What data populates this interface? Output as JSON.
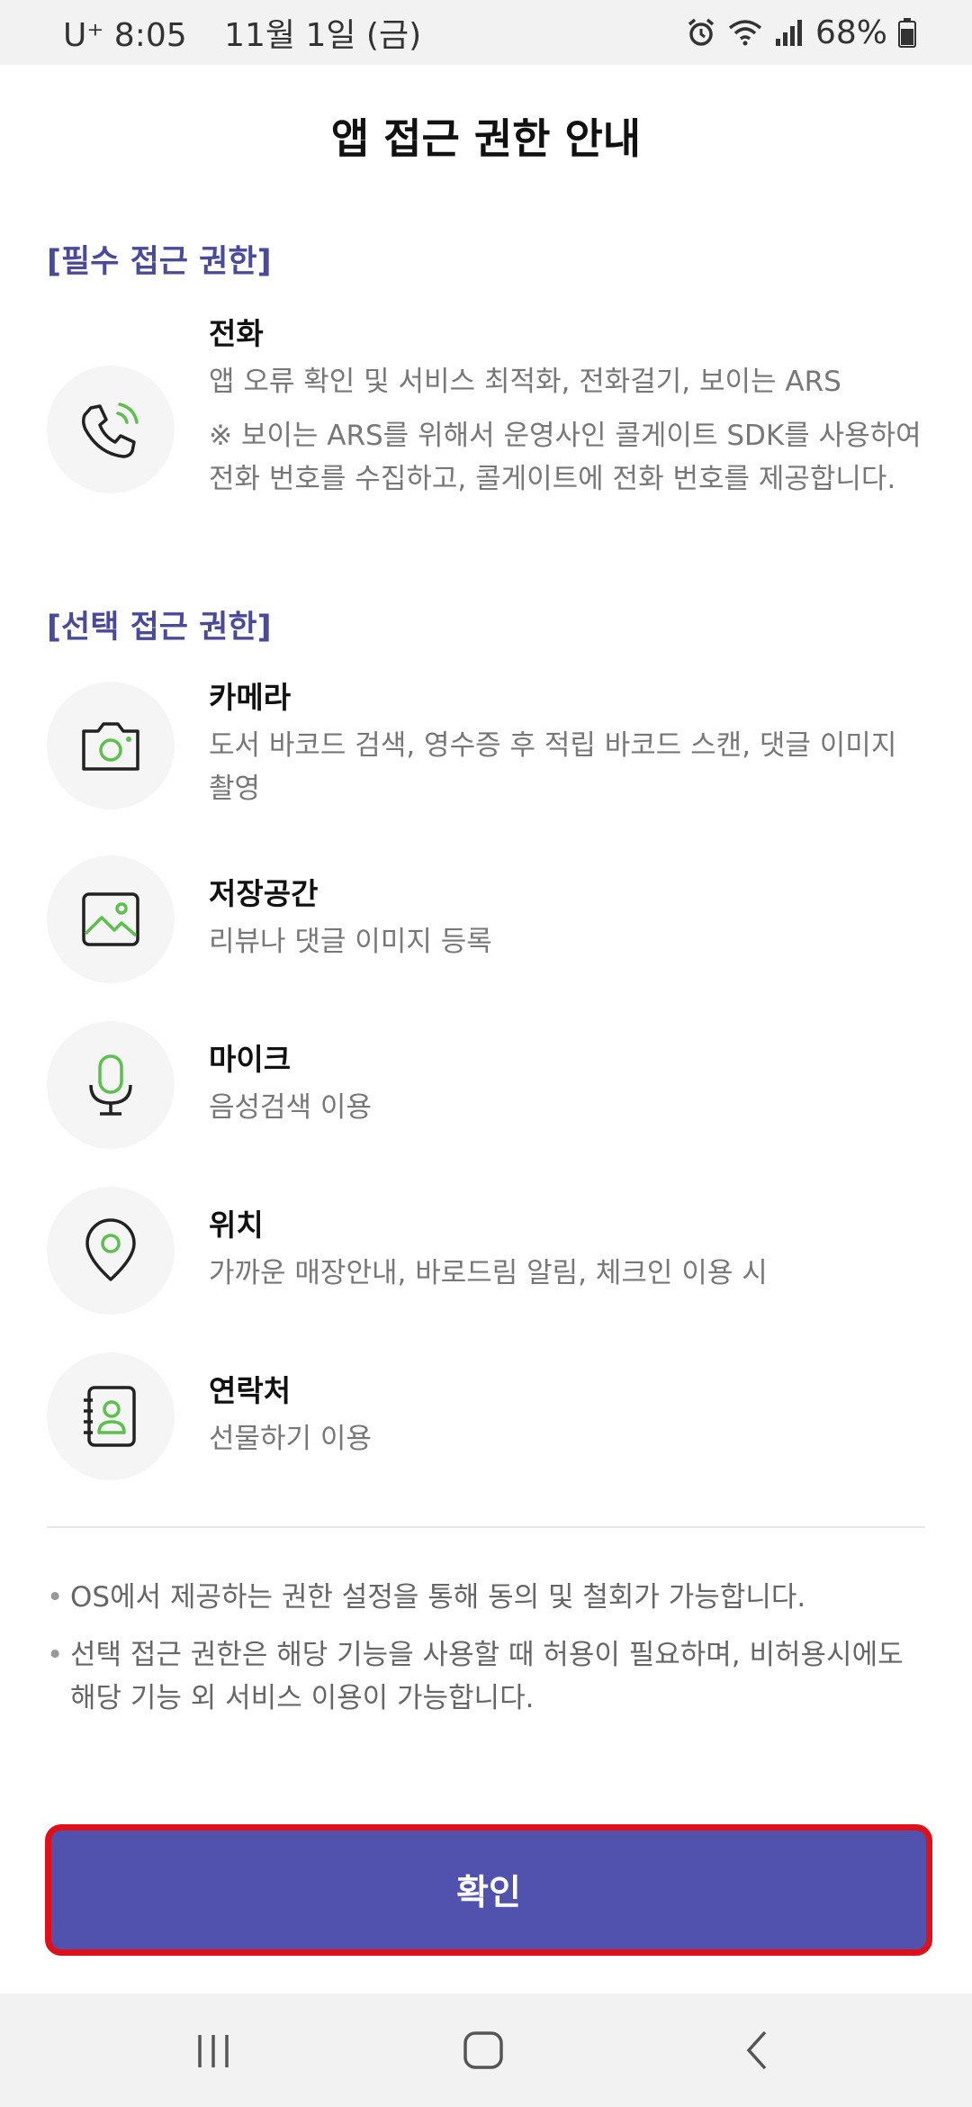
{
  "status_bar": {
    "carrier_time": "U⁺ 8:05",
    "date": "11월 1일 (금)",
    "battery": "68%"
  },
  "title": "앱 접근 권한 안내",
  "required_section": {
    "label": "[필수 접근 권한]",
    "items": [
      {
        "name": "전화",
        "desc": "앱 오류 확인 및 서비스 최적화, 전화걸기, 보이는 ARS",
        "note": "※ 보이는 ARS를 위해서 운영사인 콜게이트 SDK를 사용하여 전화 번호를 수집하고, 콜게이트에 전화 번호를 제공합니다.",
        "icon": "phone-icon"
      }
    ]
  },
  "optional_section": {
    "label": "[선택 접근 권한]",
    "items": [
      {
        "name": "카메라",
        "desc": "도서 바코드 검색, 영수증 후 적립 바코드 스캔, 댓글 이미지 촬영",
        "icon": "camera-icon"
      },
      {
        "name": "저장공간",
        "desc": "리뷰나 댓글 이미지 등록",
        "icon": "image-icon"
      },
      {
        "name": "마이크",
        "desc": "음성검색 이용",
        "icon": "microphone-icon"
      },
      {
        "name": "위치",
        "desc": "가까운 매장안내, 바로드림 알림, 체크인 이용 시",
        "icon": "location-icon"
      },
      {
        "name": "연락처",
        "desc": "선물하기 이용",
        "icon": "contacts-icon"
      }
    ]
  },
  "notes": [
    "OS에서 제공하는 권한 설정을 통해 동의 및 철회가 가능합니다.",
    "선택 접근 권한은 해당 기능을 사용할 때 허용이 필요하며, 비허용시에도 해당 기능 외 서비스 이용이 가능합니다."
  ],
  "confirm_label": "확인",
  "colors": {
    "accent": "#5052ad",
    "section_label": "#4a4a9a",
    "icon_green": "#5cbf4e",
    "highlight": "#e0101a"
  }
}
